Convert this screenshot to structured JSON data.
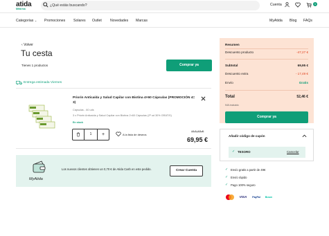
{
  "header": {
    "logo": "atida",
    "logo_sub": "Mifarma",
    "search_placeholder": "¿Qué estás buscando?",
    "account_label": "Cuenta",
    "cart_badge": "1"
  },
  "nav": {
    "left": [
      "Categorías",
      "Promociones",
      "Solares",
      "Outlet",
      "Novedades",
      "Marcas"
    ],
    "right": [
      "MyAtida",
      "Blog",
      "FAQs"
    ]
  },
  "cart": {
    "back_label": "Volver",
    "title": "Tu cesta",
    "item_count": "Tienes 1 productos",
    "checkout_label": "Comprar ya",
    "delivery": "Entrega estimada Viernes"
  },
  "product": {
    "name": "Priorin Anticaída y Salud Capilar con Biotina 4×60 Cápsulas (PROMOCIÓN 4= 3)",
    "detail_1": "Cápsulas - 60 uds",
    "detail_2": "3 x Priorin Anticaída y Salud Capilar con Biotina 2×60 Cápsulas (2ª ud 30% GRATIS)",
    "stock": "En stock",
    "quantity": "1",
    "wishlist": "A la lista de deseos",
    "old_price": "117,22 €",
    "price": "69,95 €"
  },
  "promo": {
    "brand": "MyAtida",
    "text": "Los nuevos clientes obtienen un 0,70 € de Atida Cash en este pedido.",
    "button": "Crear Cuenta"
  },
  "summary": {
    "title": "Resumen",
    "rows": [
      {
        "label": "Descuento producto",
        "value": "-47,27 €"
      },
      {
        "label": "Subtotal",
        "value": "69,95 €"
      },
      {
        "label": "Descuento extra",
        "value": "- 17,49 €"
      },
      {
        "label": "Envío",
        "value": "Gratis"
      },
      {
        "label": "Total",
        "value": "52,46 €"
      }
    ],
    "vat": "IVA incluido",
    "checkout_label": "Comprar ya"
  },
  "coupon": {
    "title": "Añadir código de cupón",
    "code": "TESORO",
    "cancel": "Cancelar"
  },
  "benefits": [
    "Envío gratis a partir de 49€",
    "Envío rápido",
    "Pago 100% seguro"
  ],
  "payments": [
    "VISA",
    "PayPal",
    "Bizum"
  ],
  "colors": {
    "green": "#0f9e78",
    "summary_bg": "#fde3d4",
    "promo_bg": "#e3f3ee",
    "discount_red": "#e0401c"
  }
}
